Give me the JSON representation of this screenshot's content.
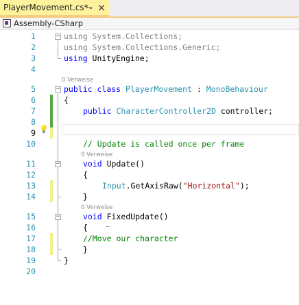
{
  "tab": {
    "title": "PlayerMovement.cs*",
    "pin_glyph": "⊸",
    "close_glyph": "×"
  },
  "nav": {
    "project": "Assembly-CSharp"
  },
  "icons": {
    "project": "csharp-project-icon",
    "lightbulb": "lightbulb-icon",
    "pin": "pin-icon",
    "close": "close-icon"
  },
  "editor": {
    "ref_label": "0 Verweise",
    "line_numbers": [
      "1",
      "2",
      "3",
      "4",
      "5",
      "6",
      "7",
      "8",
      "9",
      "10",
      "11",
      "12",
      "13",
      "14",
      "15",
      "16",
      "17",
      "18",
      "19",
      "20"
    ],
    "current_line": 9,
    "code": {
      "l1_kw": "using",
      "l1_rest": " System.Collections;",
      "l2_kw": "using",
      "l2_rest": " System.Collections.Generic;",
      "l3_kw": "using",
      "l3_rest": " UnityEngine;",
      "l5_kw1": "public",
      "l5_kw2": "class",
      "l5_class": "PlayerMovement",
      "l5_colon": " : ",
      "l5_base": "MonoBehaviour",
      "l6": "{",
      "l7_kw": "public",
      "l7_type": "CharacterController2D",
      "l7_rest": " controller;",
      "l10_cmt": "// Update is called once per frame",
      "l11_kw": "void",
      "l11_rest": " Update()",
      "l12": "{",
      "l13_type": "Input",
      "l13_mid": ".GetAxisRaw(",
      "l13_str": "\"Horizontal\"",
      "l13_end": ");",
      "l14": "}",
      "l15_kw": "void",
      "l15_rest": " FixedUpdate()",
      "l16": "{",
      "l17_cmt": "//Move our character",
      "l18": "}",
      "l19": "}"
    }
  },
  "colors": {
    "tab_active": "#fff29d",
    "saved_change": "#57a64a",
    "unsaved_change": "#efef8b",
    "keyword": "#0000ff",
    "type": "#2b91af",
    "string": "#a31515",
    "comment": "#008000"
  }
}
